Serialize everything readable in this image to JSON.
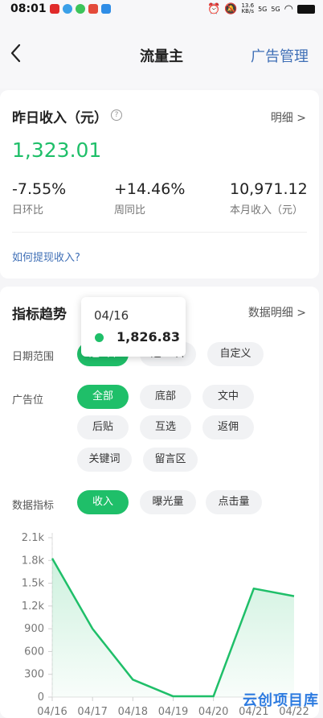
{
  "status": {
    "time": "08:01",
    "net_speed_top": "13.6",
    "net_speed_bottom": "KB/s",
    "signal1": "5G",
    "signal2": "5G"
  },
  "nav": {
    "title": "流量主",
    "action": "广告管理"
  },
  "income": {
    "title": "昨日收入（元）",
    "detail_label": "明细 >",
    "value": "1,323.01",
    "stats": [
      {
        "value": "-7.55%",
        "label": "日环比"
      },
      {
        "value": "+14.46%",
        "label": "周同比"
      },
      {
        "value": "10,971.12",
        "label": "本月收入（元）"
      }
    ],
    "howto_link": "如何提现收入?"
  },
  "trend": {
    "title": "指标趋势",
    "detail_label": "数据明细 >",
    "date_range": {
      "label": "日期范围",
      "options": [
        "近7日",
        "近30日",
        "自定义"
      ],
      "selected": "近7日"
    },
    "ad_position": {
      "label": "广告位",
      "options": [
        "全部",
        "底部",
        "文中",
        "后贴",
        "互选",
        "返佣",
        "关键词",
        "留言区"
      ],
      "selected": "全部"
    },
    "metric": {
      "label": "数据指标",
      "options": [
        "收入",
        "曝光量",
        "点击量"
      ],
      "selected": "收入"
    }
  },
  "tooltip": {
    "date": "04/16",
    "value": "1,826.83"
  },
  "colors": {
    "accent": "#1fbf69",
    "link": "#3f6fb6"
  },
  "chart_data": {
    "type": "area",
    "x": [
      "04/16",
      "04/17",
      "04/18",
      "04/19",
      "04/20",
      "04/21",
      "04/22"
    ],
    "series": [
      {
        "values": [
          1826.83,
          900,
          230,
          10,
          10,
          1430,
          1330
        ]
      }
    ],
    "y_ticks": [
      "0",
      "300",
      "600",
      "900",
      "1.2k",
      "1.5k",
      "1.8k",
      "2.1k"
    ],
    "ylim": [
      0,
      2100
    ],
    "grid": false
  },
  "watermark": "云创项目库"
}
